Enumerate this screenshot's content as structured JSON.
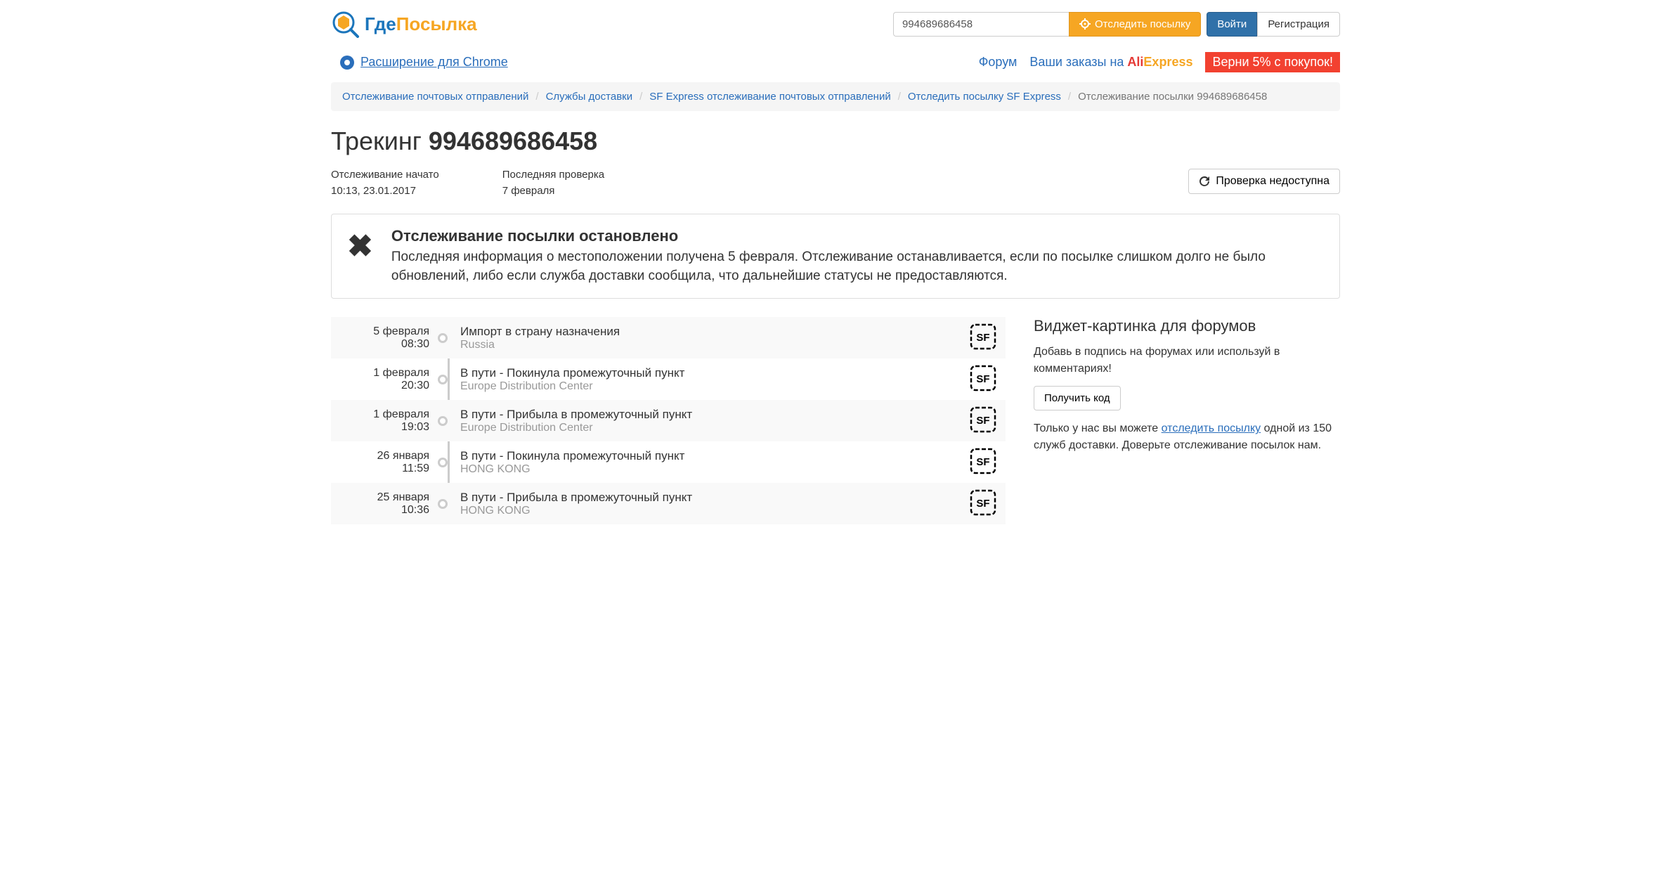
{
  "logo": {
    "part1": "Где",
    "part2": "Посылка"
  },
  "header": {
    "tracking_value": "994689686458",
    "track_btn": "Отследить посылку",
    "login_btn": "Войти",
    "register_btn": "Регистрация"
  },
  "subbar": {
    "chrome_ext": "Расширение для Chrome",
    "forum": "Форум",
    "orders_prefix": "Ваши заказы на ",
    "ali1": "Ali",
    "ali2": "Express",
    "cashback": "Верни 5% с покупок!"
  },
  "breadcrumb": {
    "items": [
      "Отслеживание почтовых отправлений",
      "Службы доставки",
      "SF Express отслеживание почтовых отправлений",
      "Отследить посылку SF Express"
    ],
    "last": "Отслеживание посылки 994689686458"
  },
  "page": {
    "title_prefix": "Трекинг ",
    "tracking": "994689686458",
    "start_label": "Отслеживание начато",
    "start_value": "10:13, 23.01.2017",
    "check_label": "Последняя проверка",
    "check_value": "7 февраля",
    "refresh_btn": "Проверка недоступна"
  },
  "alert": {
    "title": "Отслеживание посылки остановлено",
    "body": "Последняя информация о местоположении получена 5 февраля. Отслеживание останавливается, если по посылке слишком долго не было обновлений, либо если служба доставки сообщила, что дальнейшие статусы не предоставляются."
  },
  "events": [
    {
      "date": "5 февраля",
      "time": "08:30",
      "status": "Импорт в страну назначения",
      "loc": "Russia"
    },
    {
      "date": "1 февраля",
      "time": "20:30",
      "status": "В пути - Покинула промежуточный пункт",
      "loc": "Europe Distribution Center"
    },
    {
      "date": "1 февраля",
      "time": "19:03",
      "status": "В пути - Прибыла в промежуточный пункт",
      "loc": "Europe Distribution Center"
    },
    {
      "date": "26 января",
      "time": "11:59",
      "status": "В пути - Покинула промежуточный пункт",
      "loc": "HONG KONG"
    },
    {
      "date": "25 января",
      "time": "10:36",
      "status": "В пути - Прибыла в промежуточный пункт",
      "loc": "HONG KONG"
    }
  ],
  "widget": {
    "title": "Виджет-картинка для форумов",
    "desc": "Добавь в подпись на форумах или используй в комментариях!",
    "get_code": "Получить код",
    "footer1": "Только у нас вы можете ",
    "footer_link": "отследить посылку",
    "footer2": " одной из 150 служб доставки. Доверьте отслеживание посылок нам."
  }
}
